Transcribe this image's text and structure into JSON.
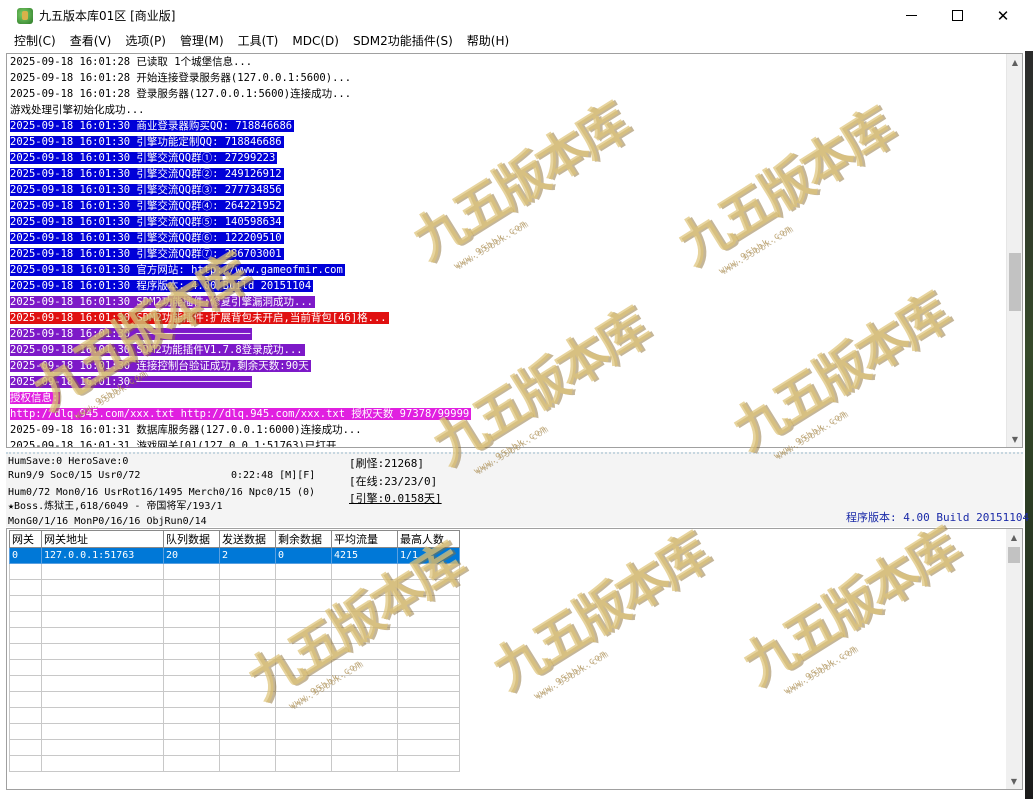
{
  "window": {
    "title": "九五版本库01区 [商业版]"
  },
  "menu": [
    "控制(C)",
    "查看(V)",
    "选项(P)",
    "管理(M)",
    "工具(T)",
    "MDC(D)",
    "SDM2功能插件(S)",
    "帮助(H)"
  ],
  "log": [
    {
      "text": "2025-09-18 16:01:28 已读取 1个城堡信息...",
      "style": "plain"
    },
    {
      "text": "2025-09-18 16:01:28 开始连接登录服务器(127.0.0.1:5600)...",
      "style": "plain"
    },
    {
      "text": "2025-09-18 16:01:28 登录服务器(127.0.0.1:5600)连接成功...",
      "style": "plain"
    },
    {
      "text": "游戏处理引擎初始化成功...",
      "style": "plain"
    },
    {
      "text": "2025-09-18 16:01:30 商业登录器购买QQ: 718846686",
      "style": "blue"
    },
    {
      "text": "2025-09-18 16:01:30 引擎功能定制QQ: 718846686",
      "style": "blue"
    },
    {
      "text": "2025-09-18 16:01:30 引擎交流QQ群①: 27299223",
      "style": "blue"
    },
    {
      "text": "2025-09-18 16:01:30 引擎交流QQ群②: 249126912",
      "style": "blue"
    },
    {
      "text": "2025-09-18 16:01:30 引擎交流QQ群③: 277734856",
      "style": "blue"
    },
    {
      "text": "2025-09-18 16:01:30 引擎交流QQ群④: 264221952",
      "style": "blue"
    },
    {
      "text": "2025-09-18 16:01:30 引擎交流QQ群⑤: 140598634",
      "style": "blue"
    },
    {
      "text": "2025-09-18 16:01:30 引擎交流QQ群⑥: 122209510",
      "style": "blue"
    },
    {
      "text": "2025-09-18 16:01:30 引擎交流QQ群⑦: 286703001",
      "style": "blue"
    },
    {
      "text": "2025-09-18 16:01:30 官方网站: http://www.gameofmir.com",
      "style": "blue"
    },
    {
      "text": "2025-09-18 16:01:30 程序版本: 4.00 Build 20151104",
      "style": "blue"
    },
    {
      "text": "2025-09-18 16:01:30 SDM2功能插件:修复引擎漏洞成功...",
      "style": "purple"
    },
    {
      "text": "2025-09-18 16:01:30 SDM2功能插件:扩展背包未开启,当前背包[46]格...",
      "style": "red"
    },
    {
      "text": "2025-09-18 16:01:30 ──────────────────",
      "style": "purple"
    },
    {
      "text": "2025-09-18 16:01:30 SDM2功能插件V1.7.8登录成功...",
      "style": "purple"
    },
    {
      "text": "2025-09-18 16:01:30 连接控制台验证成功,剩余天数:90天",
      "style": "purple"
    },
    {
      "text": "2025-09-18 16:01:30 ──────────────────",
      "style": "purple"
    },
    {
      "text": "授权信息:",
      "style": "magenta"
    },
    {
      "text": "http://dlq.945.com/xxx.txt http://dlq.945.com/xxx.txt 授权天数 97378/99999",
      "style": "magenta"
    },
    {
      "text": "2025-09-18 16:01:31 数据库服务器(127.0.0.1:6000)连接成功...",
      "style": "plain"
    },
    {
      "text": "2025-09-18 16:01:31 游戏网关[0](127.0.0.1:51763)已打开...",
      "style": "plain"
    }
  ],
  "status": {
    "line1": "HumSave:0 HeroSave:0",
    "line2": "Run9/9 Soc0/15 Usr0/72",
    "runtime": "0:22:48 [M][F]",
    "line3": "Hum0/72 Mon0/16 UsrRot16/1495 Merch0/16 Npc0/15 (0)",
    "line4": "★Boss.炼狱王,618/6049 - 帝国将军/193/1",
    "line5": "MonG0/1/16 MonP0/16/16 ObjRun0/14",
    "refresh": "[刷怪:21268]",
    "online": "[在线:23/23/0]",
    "engine": "[引擎:0.0158天]",
    "version": "程序版本: 4.00 Build 20151104"
  },
  "grid": {
    "columns": [
      "网关",
      "网关地址",
      "队列数据",
      "发送数据",
      "剩余数据",
      "平均流量",
      "最高人数"
    ],
    "rows": [
      [
        "0",
        "127.0.0.1:51763",
        "20",
        "2",
        "0",
        "4215",
        "1/1"
      ]
    ],
    "empty_rows": 13
  },
  "watermark": {
    "text": "九五版本库",
    "url": "www.95bbk.com"
  }
}
